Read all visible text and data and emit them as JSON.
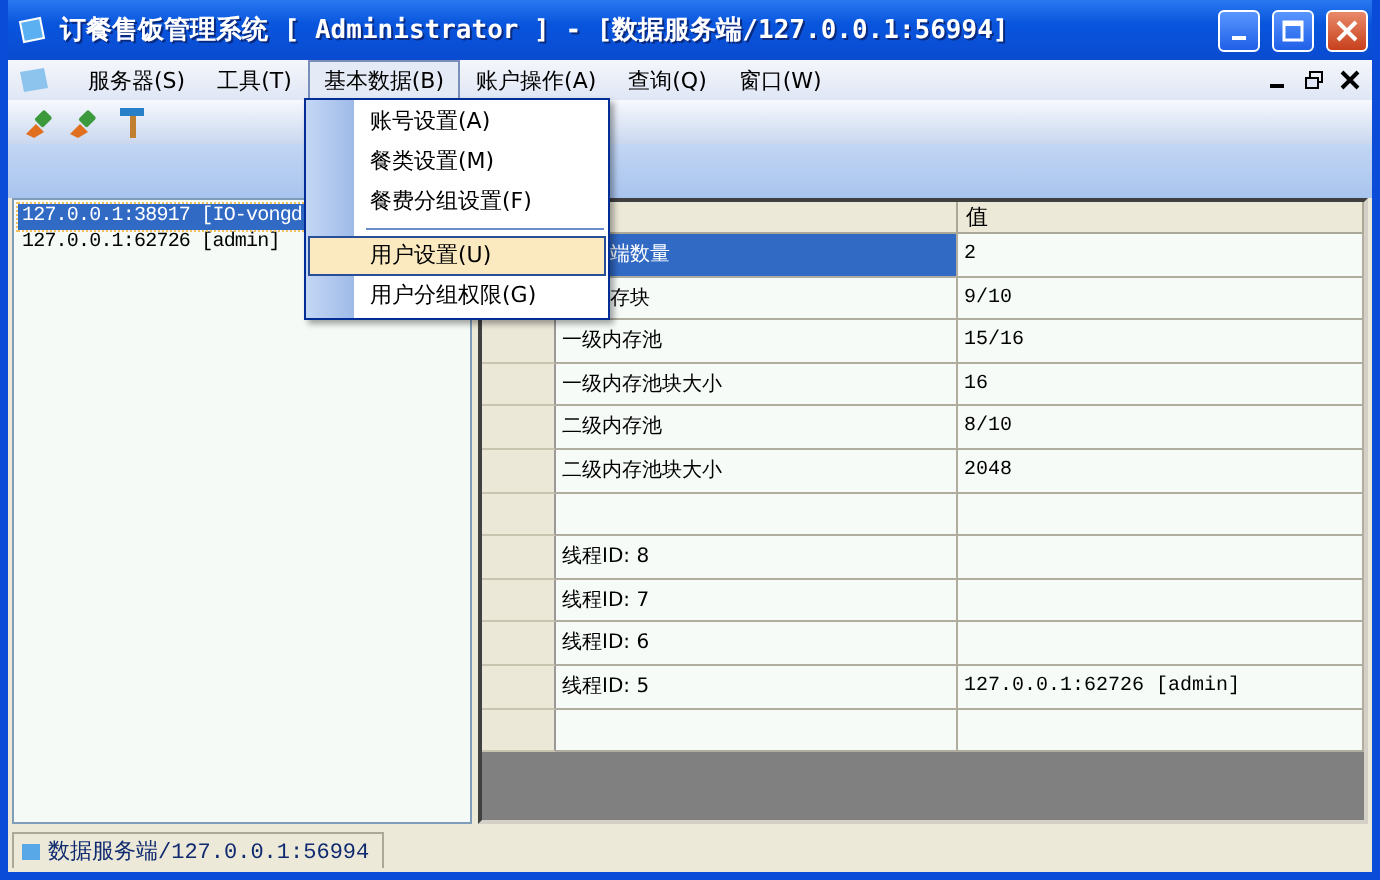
{
  "window": {
    "title": "订餐售饭管理系统 [ Administrator ] - [数据服务端/127.0.0.1:56994]"
  },
  "menu_bar": [
    {
      "label": "服务器(S)",
      "selected": false
    },
    {
      "label": "工具(T)",
      "selected": false
    },
    {
      "label": "基本数据(B)",
      "selected": true
    },
    {
      "label": "账户操作(A)",
      "selected": false
    },
    {
      "label": "查询(Q)",
      "selected": false
    },
    {
      "label": "窗口(W)",
      "selected": false
    }
  ],
  "open_menu": {
    "items": [
      {
        "kind": "item",
        "label": "账号设置(A)",
        "selected": false
      },
      {
        "kind": "item",
        "label": "餐类设置(M)",
        "selected": false
      },
      {
        "kind": "item",
        "label": "餐费分组设置(F)",
        "selected": false
      },
      {
        "kind": "separator"
      },
      {
        "kind": "item",
        "label": "用户设置(U)",
        "selected": true
      },
      {
        "kind": "item",
        "label": "用户分组权限(G)",
        "selected": false
      }
    ]
  },
  "client_list": [
    {
      "text": "127.0.0.1:38917 [IO-vongd",
      "selected": true
    },
    {
      "text": "127.0.0.1:62726 [admin]",
      "selected": false
    }
  ],
  "grid": {
    "value_header": "值",
    "rows": [
      {
        "name": "端数量",
        "value": "2",
        "selected": true,
        "covered": true
      },
      {
        "name": "存块",
        "value": "9/10",
        "selected": false,
        "covered": true
      },
      {
        "name": "一级内存池",
        "value": "15/16",
        "selected": false,
        "covered": false
      },
      {
        "name": "一级内存池块大小",
        "value": "16",
        "selected": false,
        "covered": false
      },
      {
        "name": "二级内存池",
        "value": "8/10",
        "selected": false,
        "covered": false
      },
      {
        "name": "二级内存池块大小",
        "value": "2048",
        "selected": false,
        "covered": false
      },
      {
        "selected": false
      },
      {
        "name": "线程ID: 8",
        "selected": false,
        "covered": false
      },
      {
        "name": "线程ID: 7",
        "selected": false,
        "covered": false
      },
      {
        "name": "线程ID: 6",
        "selected": false,
        "covered": false
      },
      {
        "name": "线程ID: 5",
        "value": "127.0.0.1:62726 [admin]",
        "selected": false,
        "covered": false
      },
      {
        "selected": false
      }
    ]
  },
  "status_bar": {
    "tab": "数据服务端/127.0.0.1:56994"
  }
}
